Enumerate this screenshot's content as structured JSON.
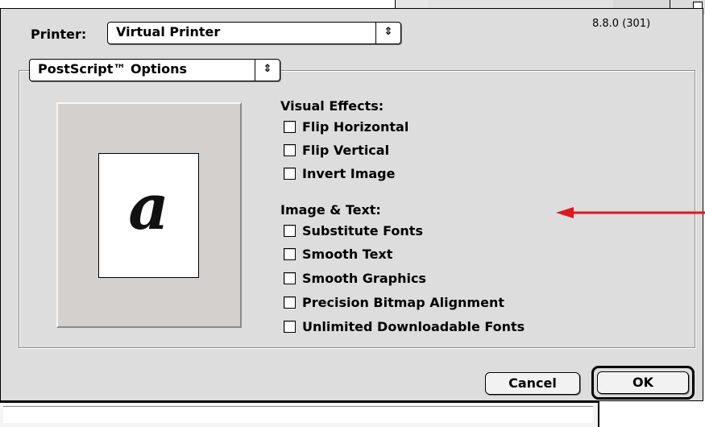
{
  "dialog": {
    "version": "8.8.0 (301)",
    "printer_label": "Printer:",
    "printer_value": "Virtual Printer",
    "panel_value": "PostScript™ Options",
    "popup_arrows_icon": "up-down-arrows-icon"
  },
  "preview": {
    "glyph": "a"
  },
  "visual_effects": {
    "heading": "Visual Effects:",
    "options": [
      {
        "label": "Flip Horizontal",
        "checked": false
      },
      {
        "label": "Flip Vertical",
        "checked": false
      },
      {
        "label": "Invert Image",
        "checked": false
      }
    ]
  },
  "image_text": {
    "heading": "Image & Text:",
    "options": [
      {
        "label": "Substitute Fonts",
        "checked": false
      },
      {
        "label": "Smooth Text",
        "checked": false
      },
      {
        "label": "Smooth Graphics",
        "checked": false
      },
      {
        "label": "Precision Bitmap Alignment",
        "checked": false
      },
      {
        "label": "Unlimited Downloadable Fonts",
        "checked": false
      }
    ]
  },
  "buttons": {
    "cancel": "Cancel",
    "ok": "OK"
  },
  "annotation": {
    "color": "#e0171f"
  }
}
